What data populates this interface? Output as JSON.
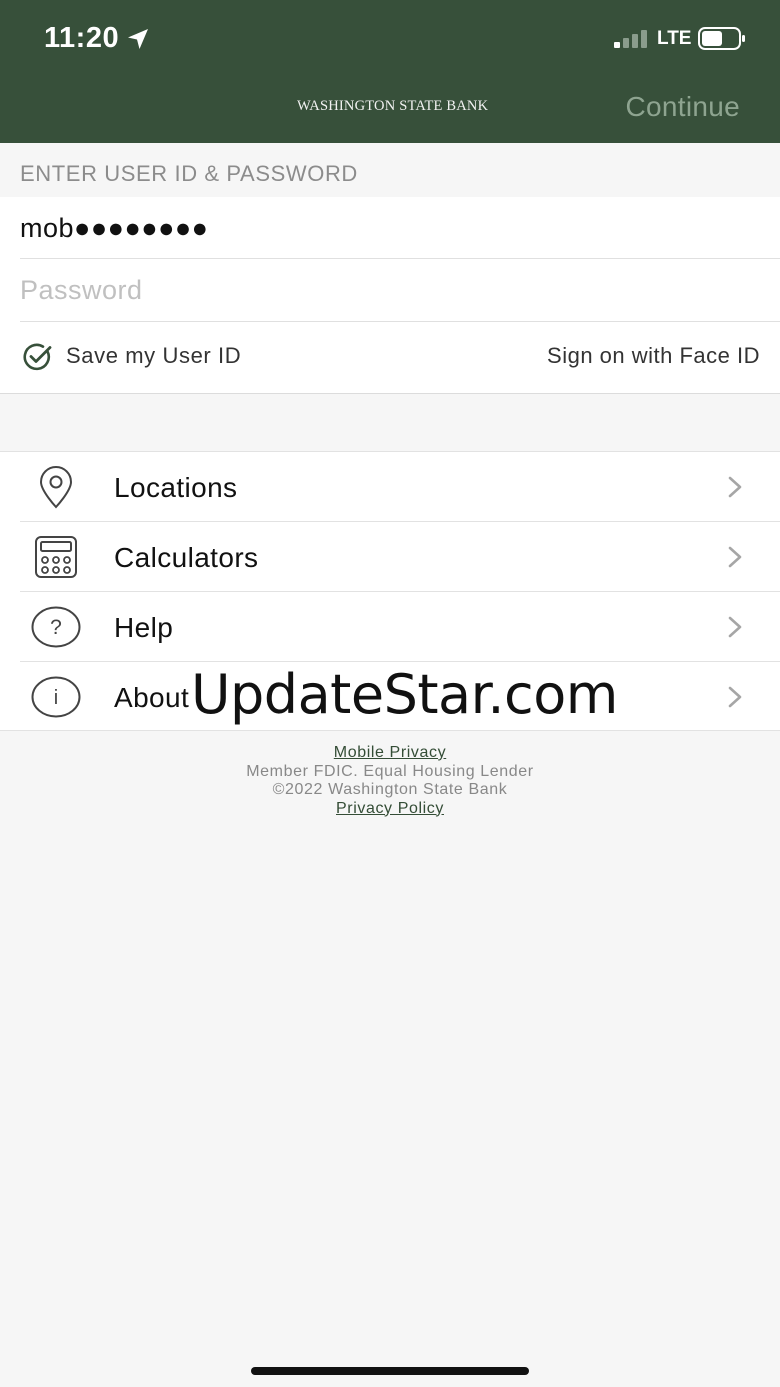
{
  "status_bar": {
    "time": "11:20",
    "network": "LTE",
    "icons": [
      "location-arrow-icon",
      "signal-icon",
      "battery-icon"
    ]
  },
  "header": {
    "logo_text": "WASHINGTON STATE BANK",
    "continue_label": "Continue",
    "background_color": "#37503a"
  },
  "login": {
    "section_label": "ENTER USER ID & PASSWORD",
    "user_id_value": "mob●●●●●●●●",
    "password_placeholder": "Password",
    "save_user_id_label": "Save my User ID",
    "face_id_label": "Sign on with Face ID"
  },
  "menu": {
    "items": [
      {
        "label": "Locations",
        "icon": "location-pin-icon"
      },
      {
        "label": "Calculators",
        "icon": "calculator-icon"
      },
      {
        "label": "Help",
        "icon": "help-icon"
      },
      {
        "label": "About",
        "icon": "info-icon"
      }
    ]
  },
  "watermark": "UpdateStar.com",
  "footer": {
    "mobile_privacy": "Mobile Privacy",
    "fdic_line": "Member FDIC. Equal Housing Lender",
    "copyright": "©2022 Washington State Bank",
    "privacy_policy": "Privacy Policy"
  }
}
